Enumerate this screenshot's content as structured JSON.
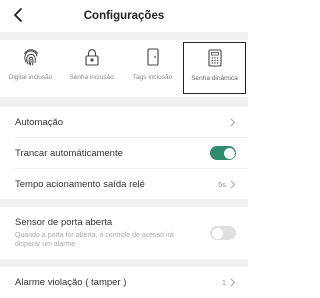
{
  "header": {
    "title": "Configurações",
    "back_icon": "chevron-left-icon"
  },
  "tabs": [
    {
      "label": "Digital inclusão",
      "icon": "fingerprint-icon",
      "active": false
    },
    {
      "label": "Senha inclusão",
      "icon": "padlock-icon",
      "active": false
    },
    {
      "label": "Tags inclusão",
      "icon": "card-icon",
      "active": false
    },
    {
      "label": "Senha dinâmica",
      "icon": "keypad-icon",
      "active": true
    }
  ],
  "settings": {
    "automacao": {
      "label": "Automação"
    },
    "trancar": {
      "label": "Trancar automáticamente",
      "enabled": true
    },
    "tempo": {
      "label": "Tempo acionamento saída relé",
      "value": "5s"
    },
    "sensor": {
      "label": "Sensor de porta aberta",
      "description": "Quando a porta for aberta, o controle de acesso irá disparar um alarme",
      "enabled": false
    },
    "alarme": {
      "label": "Alarme violação ( tamper )",
      "value": "1"
    }
  },
  "colors": {
    "toggle_on": "#2e8b6e",
    "toggle_off": "#e0e0e0",
    "section_gap": "#f1f1f1"
  }
}
